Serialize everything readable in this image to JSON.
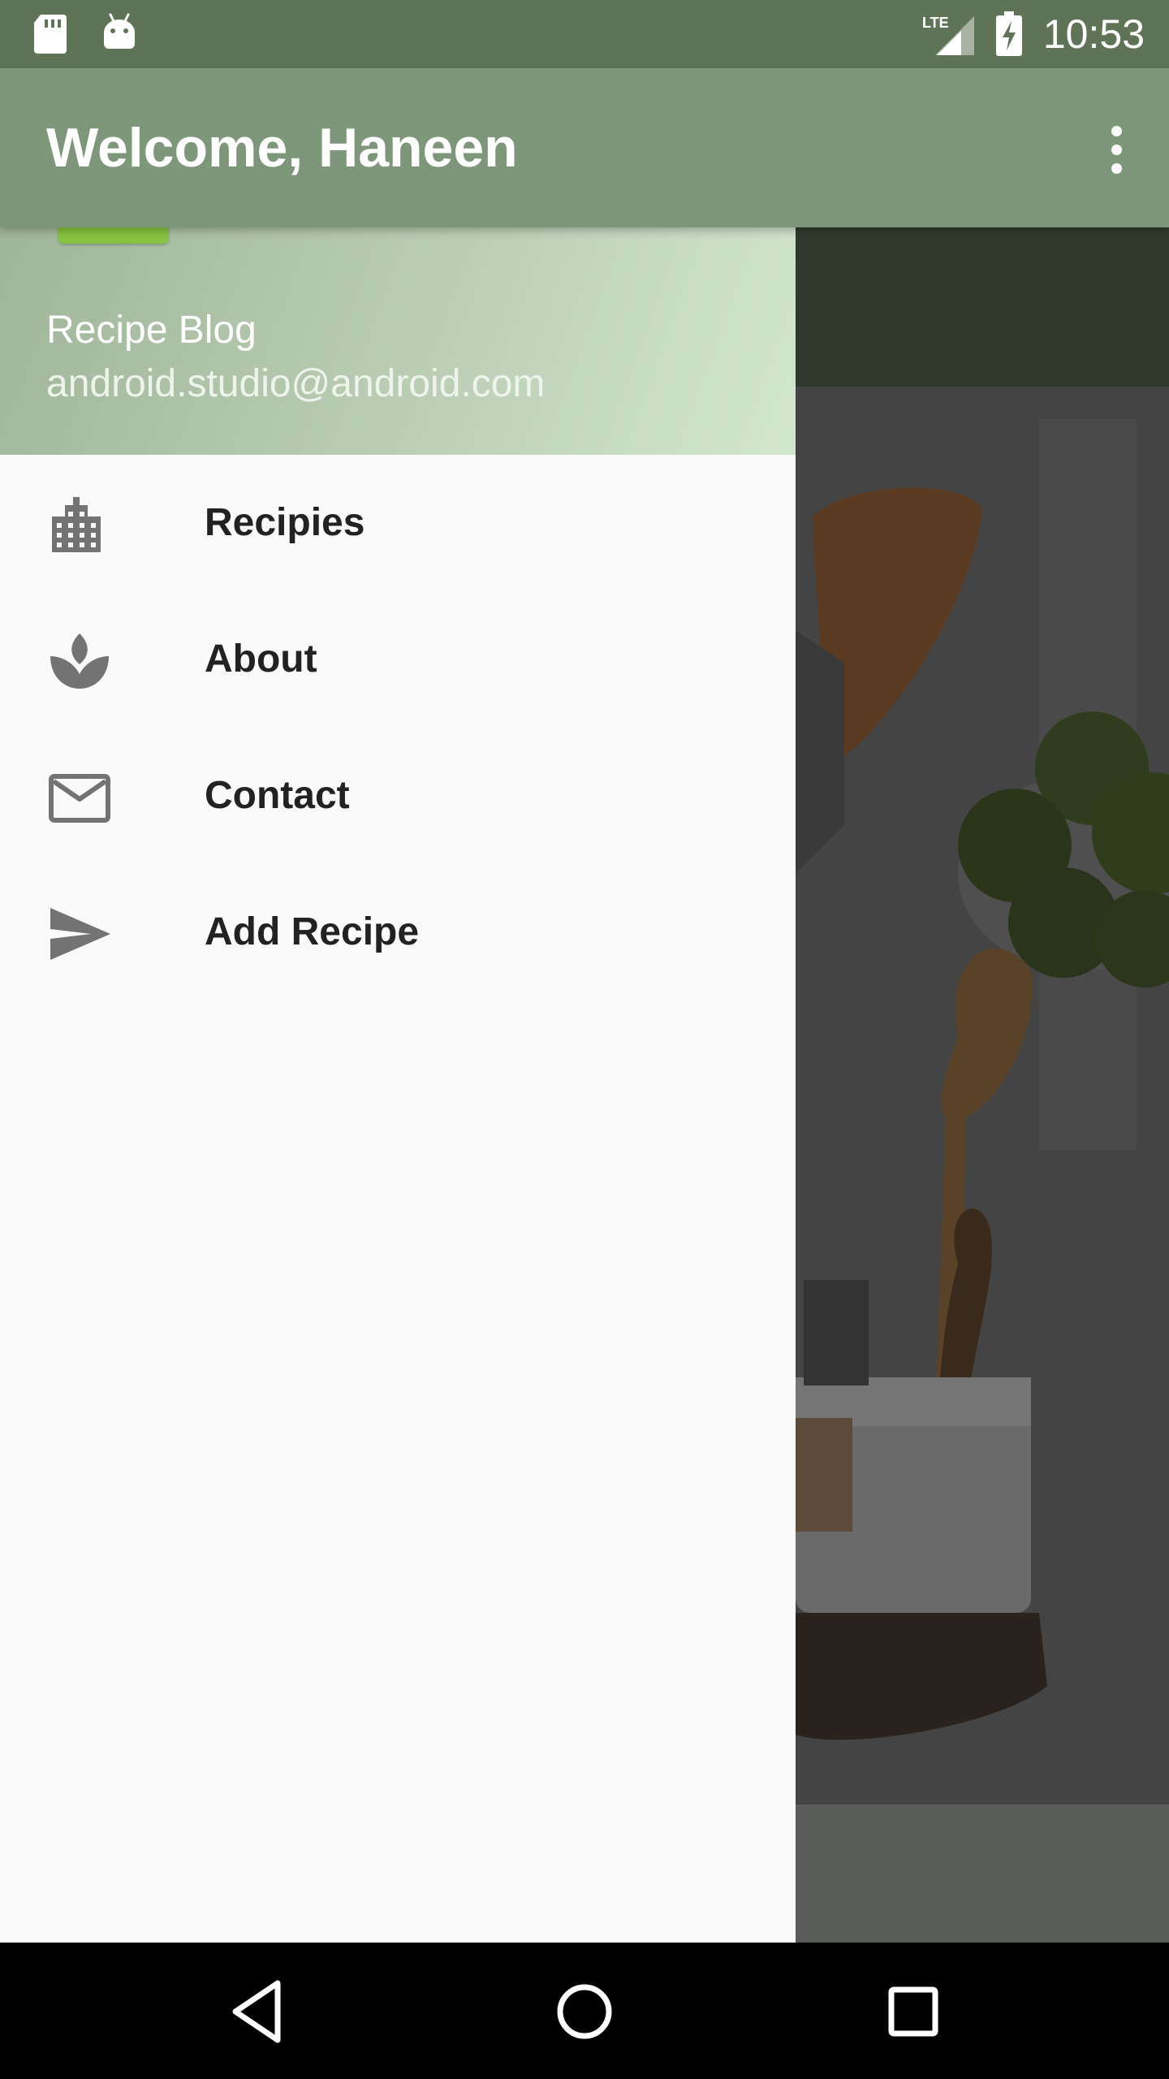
{
  "status_bar": {
    "time": "10:53",
    "network": "LTE",
    "icons": [
      "sd-card-icon",
      "android-icon",
      "lte-signal-icon",
      "battery-charging-icon"
    ]
  },
  "app_bar": {
    "title": "Welcome, Haneen",
    "overflow_icon": "more-vert-icon"
  },
  "drawer": {
    "header": {
      "name": "Recipe Blog",
      "email": "android.studio@android.com"
    },
    "items": [
      {
        "label": "Recipies",
        "icon": "building-icon"
      },
      {
        "label": "About",
        "icon": "spa-icon"
      },
      {
        "label": "Contact",
        "icon": "mail-icon"
      },
      {
        "label": "Add Recipe",
        "icon": "send-icon"
      }
    ]
  },
  "nav_bar": {
    "buttons": [
      "back-icon",
      "home-icon",
      "recents-icon"
    ]
  },
  "colors": {
    "status_bar": "#5f7456",
    "app_bar": "#7e977b",
    "drawer_background": "#fafafa",
    "icon": "#737373"
  }
}
